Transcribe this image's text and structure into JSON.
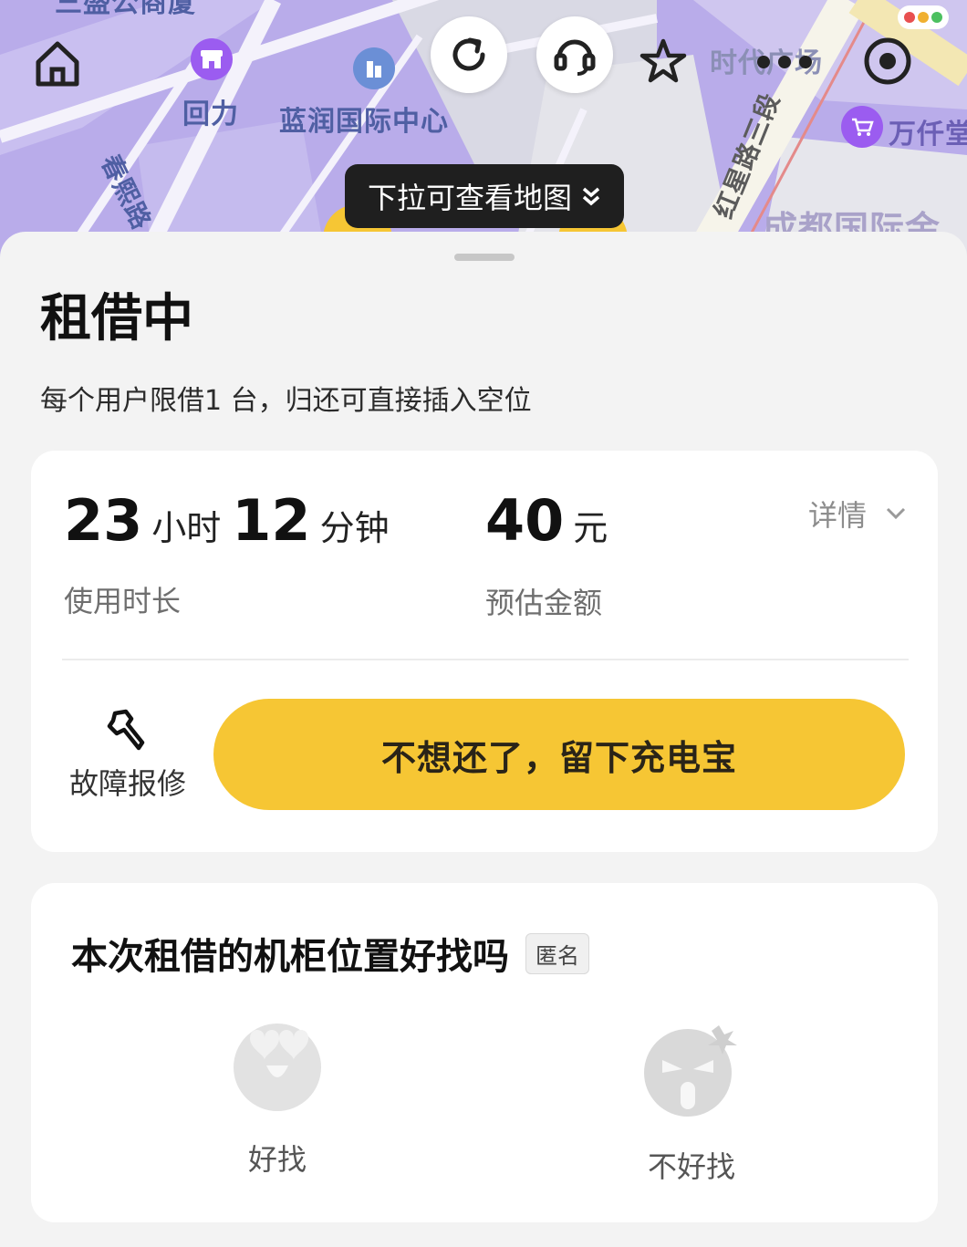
{
  "map": {
    "labels": {
      "top_partial": "三盛公商厦",
      "huili": "回力",
      "lanrun": "蓝润国际中心",
      "chunxi": "春熙路",
      "shidai": "时代广场",
      "hongxing": "红星路三段",
      "wanqian": "万仟堂",
      "chengdu": "成都国际金"
    },
    "pull_hint": "下拉可查看地图",
    "icons": {
      "home": "home-icon",
      "refresh": "refresh-icon",
      "service": "headset-icon",
      "favorite": "star-icon",
      "more": "more-icon",
      "target": "record-icon"
    }
  },
  "rental": {
    "status_title": "租借中",
    "notice": "每个用户限借1 台，归还可直接插入空位",
    "duration": {
      "hours": "23",
      "hours_unit": "小时",
      "minutes": "12",
      "minutes_unit": "分钟",
      "label": "使用时长"
    },
    "amount": {
      "value": "40",
      "unit": "元",
      "label": "预估金额"
    },
    "detail_label": "详情",
    "repair_label": "故障报修",
    "keep_button_label": "不想还了，留下充电宝"
  },
  "feedback": {
    "question": "本次租借的机柜位置好找吗",
    "anonymous_badge": "匿名",
    "options": [
      {
        "label": "好找",
        "icon": "happy-face-icon"
      },
      {
        "label": "不好找",
        "icon": "angry-face-icon"
      }
    ]
  },
  "colors": {
    "accent_yellow": "#f6c634",
    "map_purple": "#b7a8e6",
    "poi_purple": "#9b5cf0",
    "poi_blue": "#6b8fd6"
  }
}
